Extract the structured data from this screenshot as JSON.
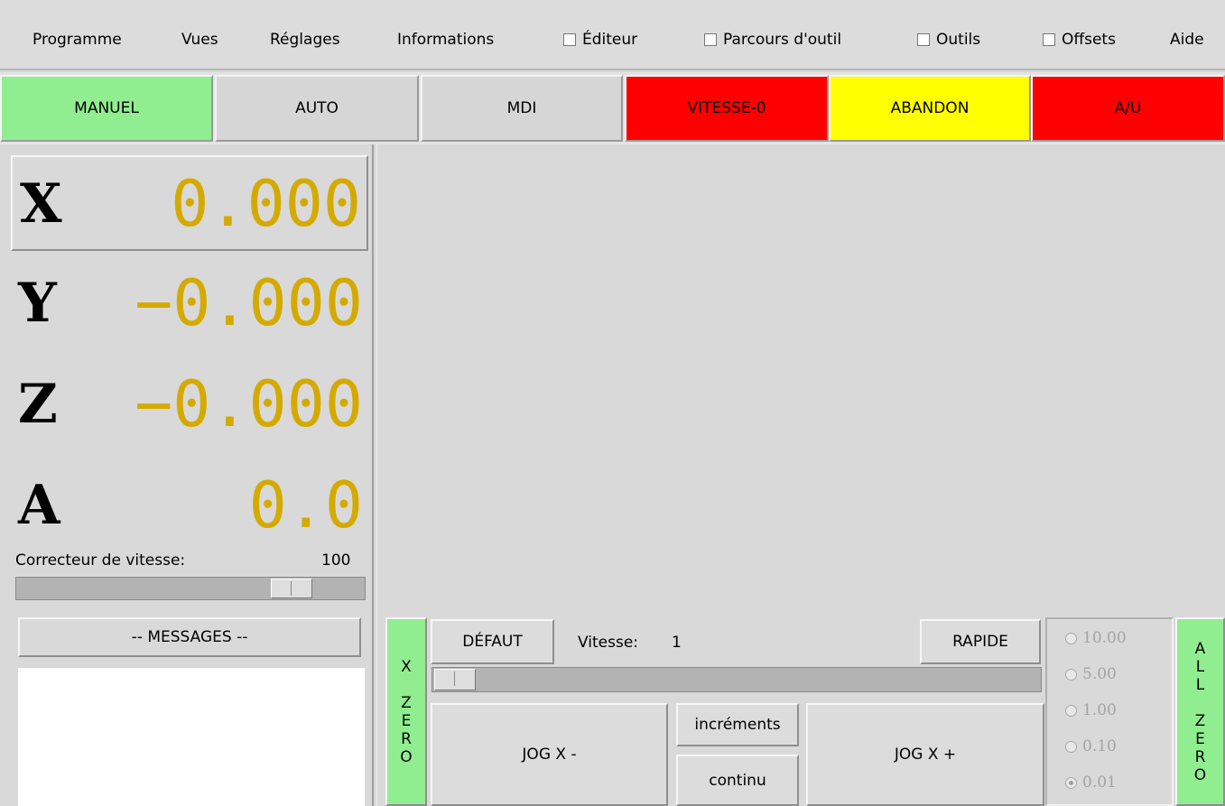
{
  "menu": {
    "items": [
      "Programme",
      "Vues",
      "Réglages",
      "Informations"
    ],
    "checks": [
      {
        "label": "Éditeur",
        "checked": false
      },
      {
        "label": "Parcours d'outil",
        "checked": false
      },
      {
        "label": "Outils",
        "checked": false
      },
      {
        "label": "Offsets",
        "checked": false
      }
    ],
    "help": "Aide"
  },
  "modes": [
    {
      "label": "MANUEL",
      "color": "#90ee90"
    },
    {
      "label": "AUTO",
      "color": "#d6d6d6"
    },
    {
      "label": "MDI",
      "color": "#d6d6d6"
    },
    {
      "label": "VITESSE-0",
      "color": "#ff0000"
    },
    {
      "label": "ABANDON",
      "color": "#ffff00"
    },
    {
      "label": "A/U",
      "color": "#ff0000"
    }
  ],
  "dro": [
    {
      "axis": "X",
      "value": "0.000"
    },
    {
      "axis": "Y",
      "value": "−0.000"
    },
    {
      "axis": "Z",
      "value": "−0.000"
    },
    {
      "axis": "A",
      "value": "0.0"
    }
  ],
  "dro_value_color": "#d4aa00",
  "feed_override": {
    "label": "Correcteur de vitesse:",
    "value": "100"
  },
  "messages_label": "-- MESSAGES --",
  "jog": {
    "zero_x_letters": [
      "X",
      "Z",
      "E",
      "R",
      "O"
    ],
    "default_label": "DÉFAUT",
    "speed_label": "Vitesse:",
    "speed_value": "1",
    "rapid_label": "RAPIDE",
    "jog_minus": "JOG X -",
    "jog_plus": "JOG X +",
    "increments_label": "incréments",
    "continuous_label": "continu",
    "steps": [
      {
        "label": "10.00",
        "selected": false
      },
      {
        "label": "5.00",
        "selected": false
      },
      {
        "label": "1.00",
        "selected": false
      },
      {
        "label": "0.10",
        "selected": false
      },
      {
        "label": "0.01",
        "selected": true
      }
    ],
    "all_zero_letters": [
      "A",
      "L",
      "L",
      "",
      "Z",
      "E",
      "R",
      "O"
    ]
  }
}
